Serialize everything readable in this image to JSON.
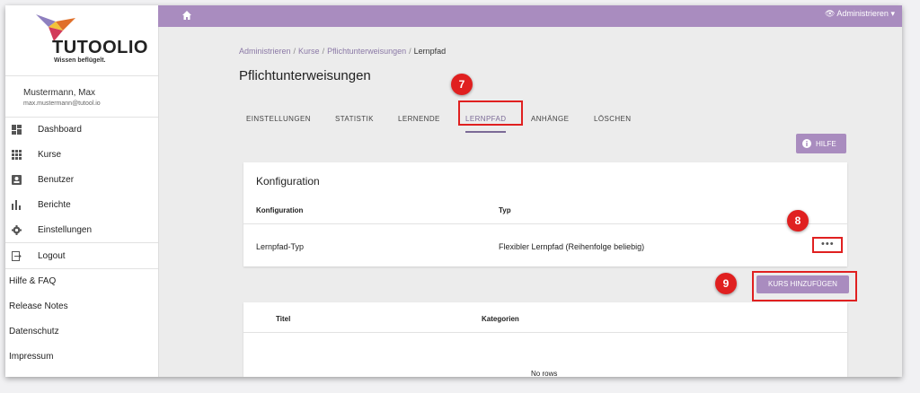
{
  "brand": {
    "name": "TUTOOLIO",
    "tagline": "Wissen beflügelt."
  },
  "user": {
    "name": "Mustermann, Max",
    "email": "max.mustermann@tutool.io"
  },
  "sidebar": {
    "nav": [
      {
        "label": "Dashboard",
        "icon": "dashboard-icon"
      },
      {
        "label": "Kurse",
        "icon": "grid-icon"
      },
      {
        "label": "Benutzer",
        "icon": "user-card-icon"
      },
      {
        "label": "Berichte",
        "icon": "bar-chart-icon"
      },
      {
        "label": "Einstellungen",
        "icon": "gear-icon"
      }
    ],
    "logout": "Logout",
    "links": [
      "Hilfe & FAQ",
      "Release Notes",
      "Datenschutz",
      "Impressum"
    ]
  },
  "topbar": {
    "admin_label": "Administrieren"
  },
  "breadcrumb": [
    "Administrieren",
    "Kurse",
    "Pflichtunterweisungen",
    "Lernpfad"
  ],
  "page_title": "Pflichtunterweisungen",
  "tabs": [
    "EINSTELLUNGEN",
    "STATISTIK",
    "LERNENDE",
    "LERNPFAD",
    "ANHÄNGE",
    "LÖSCHEN"
  ],
  "active_tab": "LERNPFAD",
  "help_button": "HILFE",
  "config": {
    "title": "Konfiguration",
    "columns": [
      "Konfiguration",
      "Typ"
    ],
    "rows": [
      {
        "name": "Lernpfad-Typ",
        "type": "Flexibler Lernpfad (Reihenfolge beliebig)"
      }
    ],
    "menu_label": "•••"
  },
  "add_course_button": "KURS HINZUFÜGEN",
  "courses": {
    "columns": [
      "Titel",
      "Kategorien"
    ],
    "empty_text": "No rows"
  },
  "callouts": {
    "tab": "7",
    "menu": "8",
    "add": "9"
  },
  "colors": {
    "accent": "#a98cbf",
    "callout": "#e02020"
  }
}
